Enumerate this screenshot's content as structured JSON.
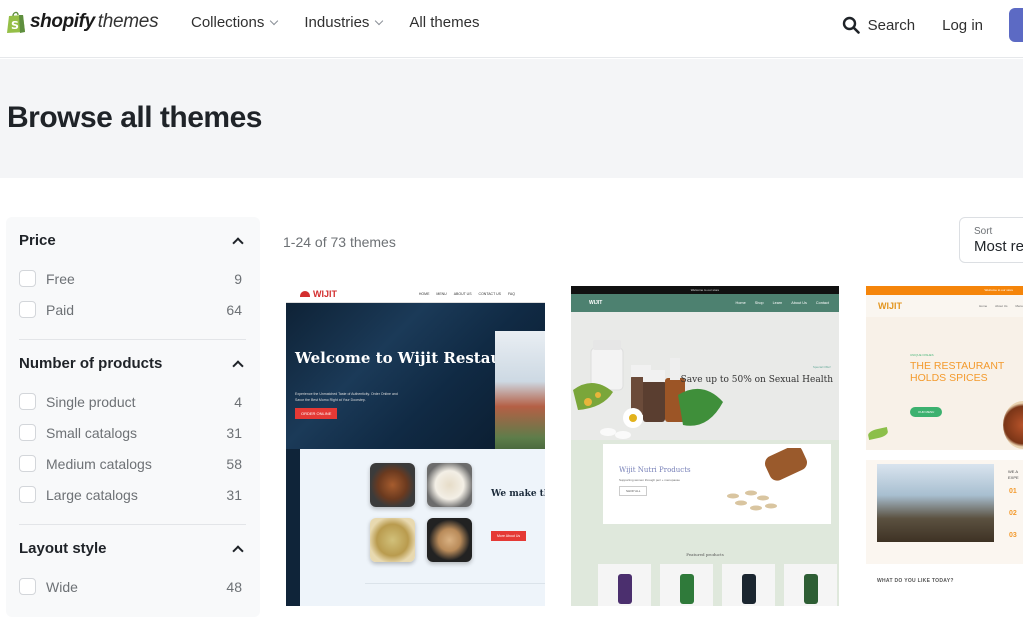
{
  "header": {
    "brand": "shopify",
    "brand_sub": "themes",
    "nav": [
      {
        "label": "Collections",
        "has_dropdown": true
      },
      {
        "label": "Industries",
        "has_dropdown": true
      },
      {
        "label": "All themes",
        "has_dropdown": false
      }
    ],
    "search_label": "Search",
    "login_label": "Log in",
    "colors": {
      "brand_green": "#95bf47",
      "cta": "#5c6ac4"
    }
  },
  "hero": {
    "title": "Browse all themes"
  },
  "filters": [
    {
      "title": "Price",
      "expanded": true,
      "options": [
        {
          "label": "Free",
          "count": "9",
          "checked": false
        },
        {
          "label": "Paid",
          "count": "64",
          "checked": false
        }
      ]
    },
    {
      "title": "Number of products",
      "expanded": true,
      "options": [
        {
          "label": "Single product",
          "count": "4",
          "checked": false
        },
        {
          "label": "Small catalogs",
          "count": "31",
          "checked": false
        },
        {
          "label": "Medium catalogs",
          "count": "58",
          "checked": false
        },
        {
          "label": "Large catalogs",
          "count": "31",
          "checked": false
        }
      ]
    },
    {
      "title": "Layout style",
      "expanded": true,
      "options": [
        {
          "label": "Wide",
          "count": "48",
          "checked": false
        }
      ]
    }
  ],
  "results": {
    "count_text": "1-24 of 73 themes",
    "sort_label": "Sort",
    "sort_value": "Most re"
  },
  "themes": [
    {
      "logo": "WIJIT",
      "nav": [
        "HOME",
        "MENU",
        "ABOUT US",
        "CONTACT US",
        "FAQ"
      ],
      "headline": "Welcome to Wijit Restaurant",
      "subtext": "Experience the Unmatched Taste of Authenticity. Order Online and Savor the Best Momo Right at Your Doorstep.",
      "button": "ORDER ONLINE",
      "section_title": "We make the MOMO in to",
      "section_button": "More About Us"
    },
    {
      "topbar": "Welcome to our store",
      "logo": "WIJIT",
      "nav": [
        "Home",
        "Shop",
        "Learn",
        "About Us",
        "Contact"
      ],
      "offer_tag": "Special Offer!",
      "headline": "Save up to 50% on Sexual Health",
      "panel_title": "Wijit Nutri Products",
      "panel_sub": "Supporting women through peri + menopause",
      "panel_button": "SHOP ALL",
      "featured": "Featured products"
    },
    {
      "topbar": "Welcome to our store",
      "logo": "WIJIT",
      "nav": [
        "Home",
        "About Us",
        "Menu"
      ],
      "tag": "UNIQUE DISHES",
      "headline": "THE RESTAURANT HOLDS SPICES",
      "button": "OUR MENU",
      "side_title": "WE A EXPE",
      "numbers": [
        "01",
        "02",
        "03"
      ],
      "question": "WHAT DO YOU LIKE TODAY?"
    }
  ]
}
